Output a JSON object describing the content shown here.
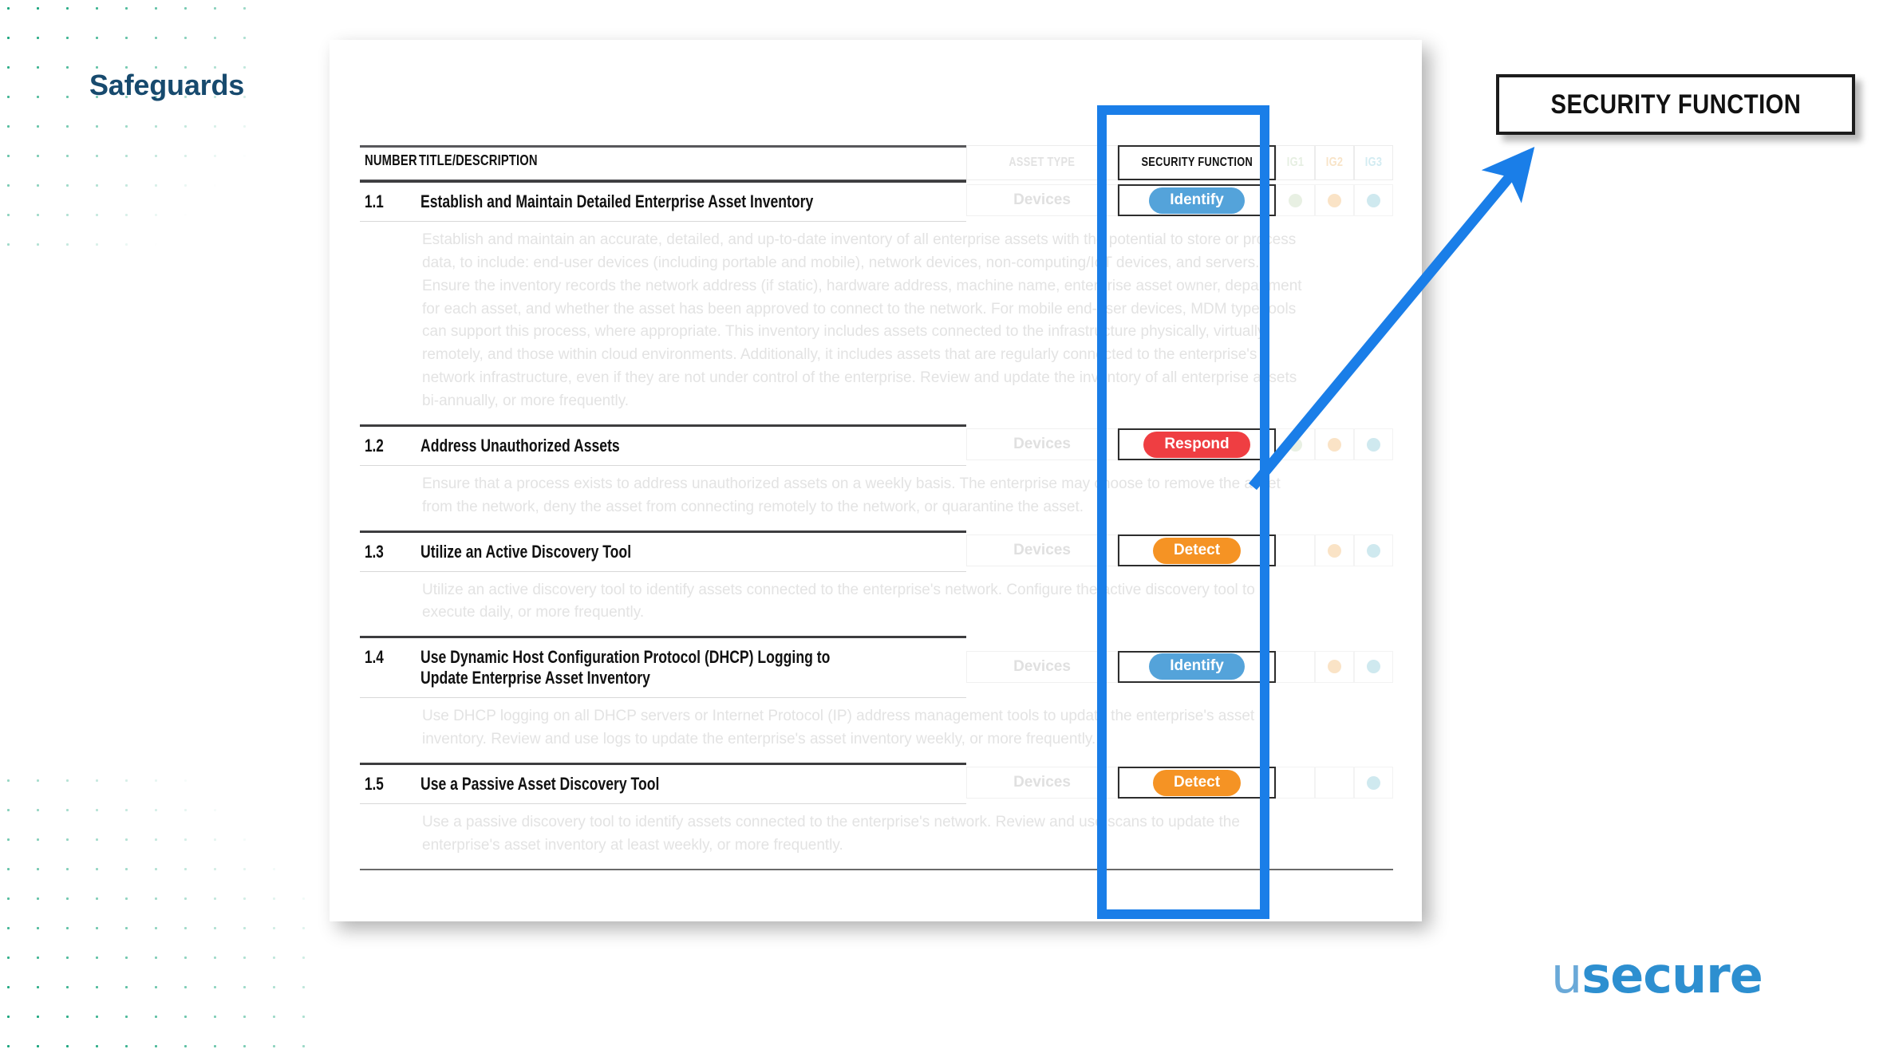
{
  "slide": {
    "title": "Safeguards",
    "accent_blue": "#1a7ee8",
    "title_color": "#174a6e",
    "dot_pattern_color": "#18a57c"
  },
  "table": {
    "header": {
      "number": "NUMBER",
      "title_description": "TITLE/DESCRIPTION",
      "asset_type": "ASSET TYPE",
      "security_function": "SECURITY FUNCTION",
      "ig1": "IG1",
      "ig2": "IG2",
      "ig3": "IG3"
    },
    "rows": [
      {
        "number": "1.1",
        "title": "Establish and Maintain Detailed Enterprise Asset Inventory",
        "description": "Establish and maintain an accurate, detailed, and up-to-date inventory of all enterprise assets with the potential to store or process data, to include: end-user devices (including portable and mobile), network devices, non-computing/IoT devices, and servers. Ensure the inventory records the network address (if static), hardware address, machine name, enterprise asset owner, department for each asset, and whether the asset has been approved to connect to the network. For mobile end-user devices, MDM type tools can support this process, where appropriate. This inventory includes assets connected to the infrastructure physically, virtually, remotely, and those within cloud environments. Additionally, it includes assets that are regularly connected to the enterprise's network infrastructure, even if they are not under control of the enterprise. Review and update the inventory of all enterprise assets bi-annually, or more frequently.",
        "asset_type": "Devices",
        "security_function": "Identify",
        "security_function_color": "#54a3da",
        "ig1": true,
        "ig2": true,
        "ig3": true
      },
      {
        "number": "1.2",
        "title": "Address Unauthorized Assets",
        "description": "Ensure that a process exists to address unauthorized assets on a weekly basis. The enterprise may choose to remove the asset from the network, deny the asset from connecting remotely to the network, or quarantine the asset.",
        "asset_type": "Devices",
        "security_function": "Respond",
        "security_function_color": "#ef3e42",
        "ig1": true,
        "ig2": true,
        "ig3": true
      },
      {
        "number": "1.3",
        "title": "Utilize an Active Discovery Tool",
        "description": "Utilize an active discovery tool to identify assets connected to the enterprise's network. Configure the active discovery tool to execute daily, or more frequently.",
        "asset_type": "Devices",
        "security_function": "Detect",
        "security_function_color": "#f59324",
        "ig1": false,
        "ig2": true,
        "ig3": true
      },
      {
        "number": "1.4",
        "title": "Use Dynamic Host Configuration Protocol (DHCP) Logging to Update Enterprise Asset Inventory",
        "description": "Use DHCP logging on all DHCP servers or Internet Protocol (IP) address management tools to update the enterprise's asset inventory. Review and use logs to update the enterprise's asset inventory weekly, or more frequently.",
        "asset_type": "Devices",
        "security_function": "Identify",
        "security_function_color": "#54a3da",
        "ig1": false,
        "ig2": true,
        "ig3": true
      },
      {
        "number": "1.5",
        "title": "Use a Passive Asset Discovery Tool",
        "description": "Use a passive discovery tool to identify assets connected to the enterprise's network. Review and use scans to update the enterprise's asset inventory at least weekly, or more frequently.",
        "asset_type": "Devices",
        "security_function": "Detect",
        "security_function_color": "#f59324",
        "ig1": false,
        "ig2": false,
        "ig3": true
      }
    ],
    "ig_dot_colors": {
      "ig1": "#e8f0e3",
      "ig2": "#fae3c6",
      "ig3": "#cfe9ef"
    }
  },
  "annotation": {
    "callout_label": "SECURITY FUNCTION",
    "highlight_color": "#1a7ee8"
  },
  "brand": {
    "logo_u": "u",
    "logo_rest": "secure"
  }
}
